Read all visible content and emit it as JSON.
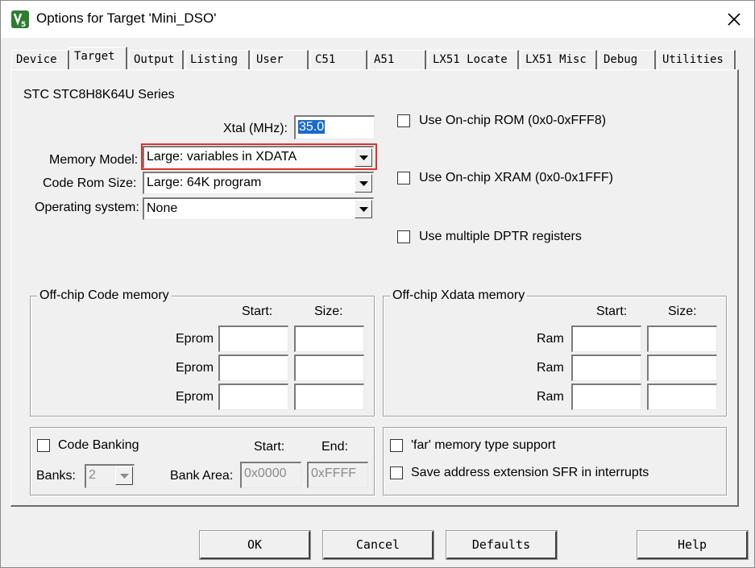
{
  "window": {
    "title": "Options for Target 'Mini_DSO'",
    "app_icon": "uvision-icon",
    "close_icon": "close-icon"
  },
  "tabs": [
    {
      "label": "Device"
    },
    {
      "label": "Target"
    },
    {
      "label": "Output"
    },
    {
      "label": "Listing"
    },
    {
      "label": "User"
    },
    {
      "label": "C51"
    },
    {
      "label": "A51"
    },
    {
      "label": "LX51 Locate"
    },
    {
      "label": "LX51 Misc"
    },
    {
      "label": "Debug"
    },
    {
      "label": "Utilities"
    }
  ],
  "active_tab": "Target",
  "device": {
    "series": "STC STC8H8K64U Series"
  },
  "xtal": {
    "label": "Xtal (MHz):",
    "value": "35.0"
  },
  "memory_model": {
    "label": "Memory Model:",
    "value": "Large: variables in XDATA"
  },
  "code_rom_size": {
    "label": "Code Rom Size:",
    "value": "Large: 64K program"
  },
  "operating_system": {
    "label": "Operating system:",
    "value": "None"
  },
  "options": {
    "onchip_rom": {
      "label": "Use On-chip ROM (0x0-0xFFF8)",
      "checked": false
    },
    "onchip_xram": {
      "label": "Use On-chip XRAM (0x0-0x1FFF)",
      "checked": false
    },
    "multiple_dptr": {
      "label": "Use multiple DPTR registers",
      "checked": false
    }
  },
  "offchip_code": {
    "title": "Off-chip Code memory",
    "start_header": "Start:",
    "size_header": "Size:",
    "rows": [
      {
        "label": "Eprom",
        "start": "",
        "size": ""
      },
      {
        "label": "Eprom",
        "start": "",
        "size": ""
      },
      {
        "label": "Eprom",
        "start": "",
        "size": ""
      }
    ]
  },
  "offchip_xdata": {
    "title": "Off-chip Xdata memory",
    "start_header": "Start:",
    "size_header": "Size:",
    "rows": [
      {
        "label": "Ram",
        "start": "",
        "size": ""
      },
      {
        "label": "Ram",
        "start": "",
        "size": ""
      },
      {
        "label": "Ram",
        "start": "",
        "size": ""
      }
    ]
  },
  "banking": {
    "code_banking_label": "Code Banking",
    "code_banking_checked": false,
    "start_header": "Start:",
    "end_header": "End:",
    "banks_label": "Banks:",
    "banks_value": "2",
    "bank_area_label": "Bank Area:",
    "bank_area_start": "0x0000",
    "bank_area_end": "0xFFFF"
  },
  "misc": {
    "far_memory": {
      "label": "'far' memory type support",
      "checked": false
    },
    "save_sfr": {
      "label": "Save address extension SFR in interrupts",
      "checked": false
    }
  },
  "buttons": {
    "ok": "OK",
    "cancel": "Cancel",
    "defaults": "Defaults",
    "help": "Help"
  },
  "colors": {
    "highlight": "#e03030",
    "selection": "#1b6ac9",
    "dialog_bg": "#f0f0f0"
  }
}
